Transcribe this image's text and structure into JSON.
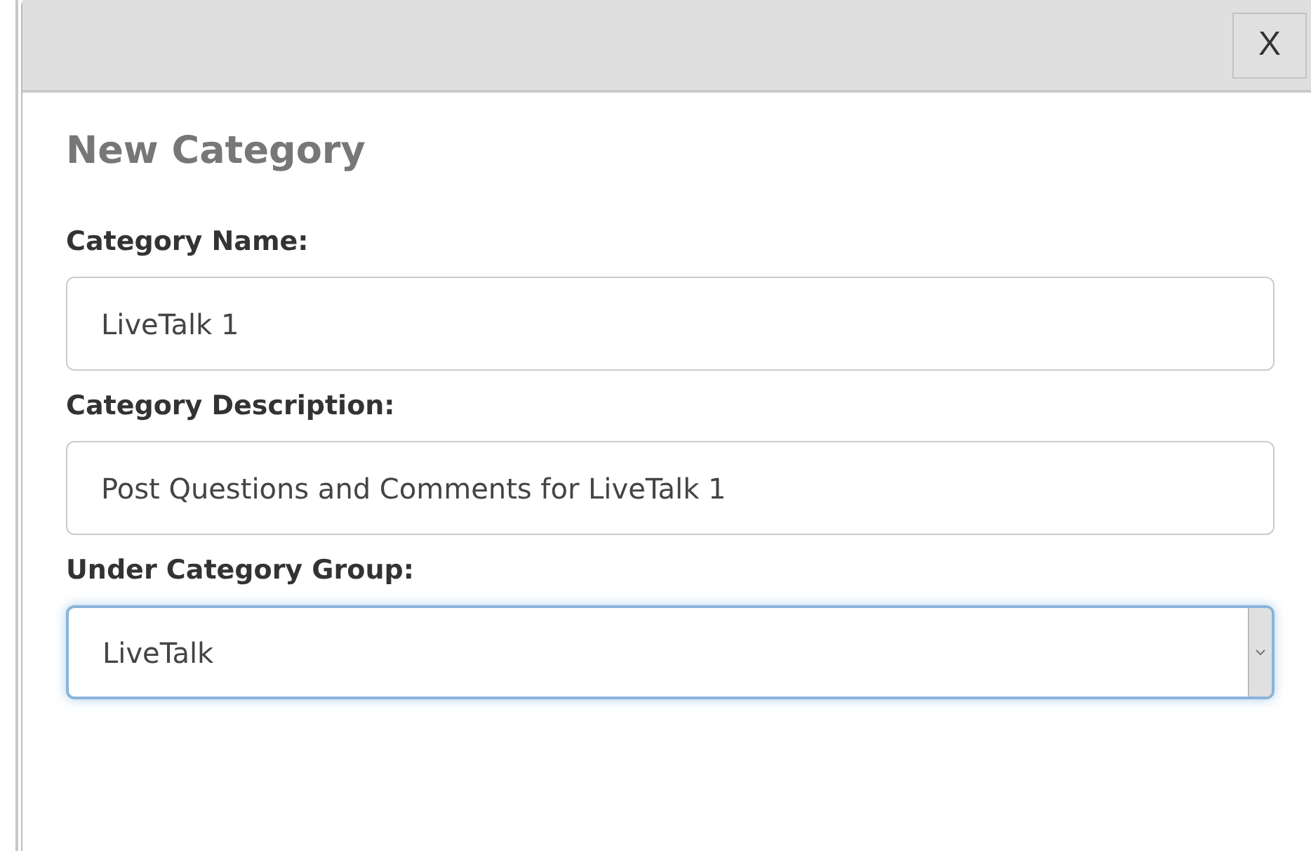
{
  "dialog": {
    "close_label": "X",
    "title": "New Category",
    "fields": [
      {
        "kind": "text",
        "label": "Category Name:",
        "value": "LiveTalk 1",
        "focused": false
      },
      {
        "kind": "text",
        "label": "Category Description:",
        "value": "Post Questions and Comments for LiveTalk 1",
        "focused": false
      },
      {
        "kind": "select",
        "label": "Under Category Group:",
        "value": "LiveTalk",
        "focused": true
      }
    ]
  }
}
